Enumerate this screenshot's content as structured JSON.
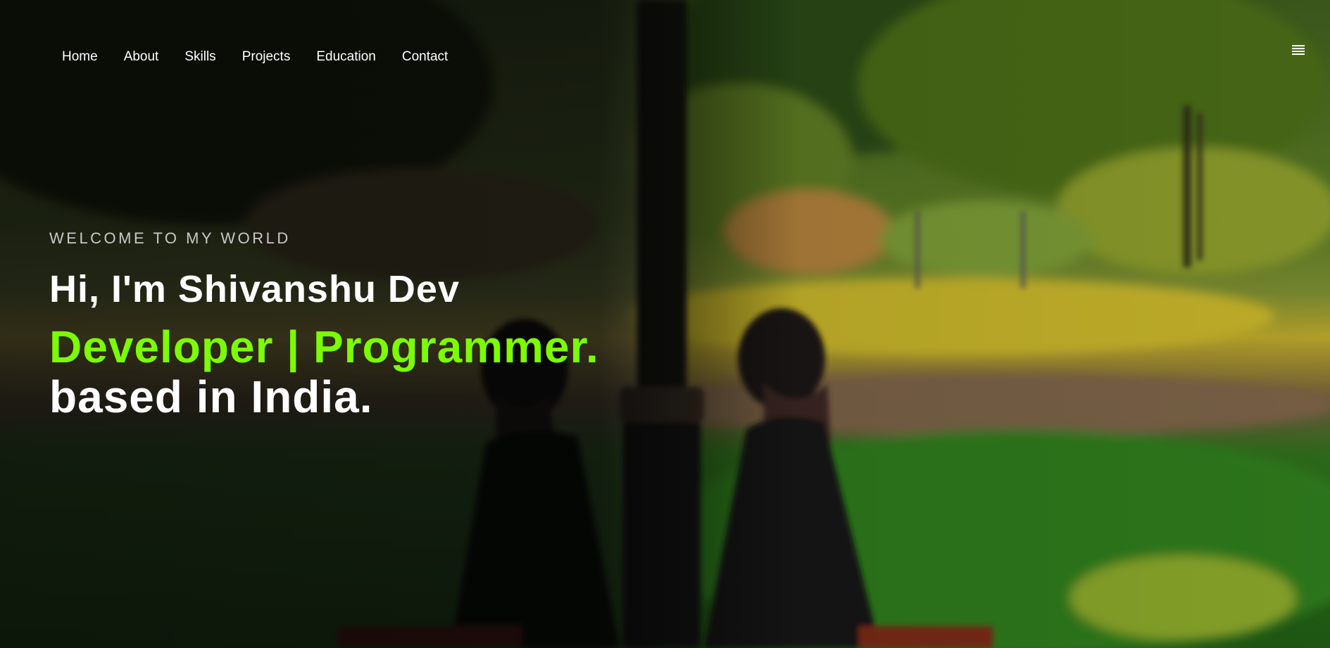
{
  "nav": {
    "items": [
      {
        "label": "Home"
      },
      {
        "label": "About"
      },
      {
        "label": "Skills"
      },
      {
        "label": "Projects"
      },
      {
        "label": "Education"
      },
      {
        "label": "Contact"
      }
    ],
    "menu_icon": "hamburger-menu-icon"
  },
  "hero": {
    "eyebrow": "WELCOME TO MY WORLD",
    "headline": "Hi, I'm Shivanshu Dev",
    "roles": "Developer | Programmer.",
    "location": "based in India.",
    "accent_color": "#7cfc00"
  }
}
